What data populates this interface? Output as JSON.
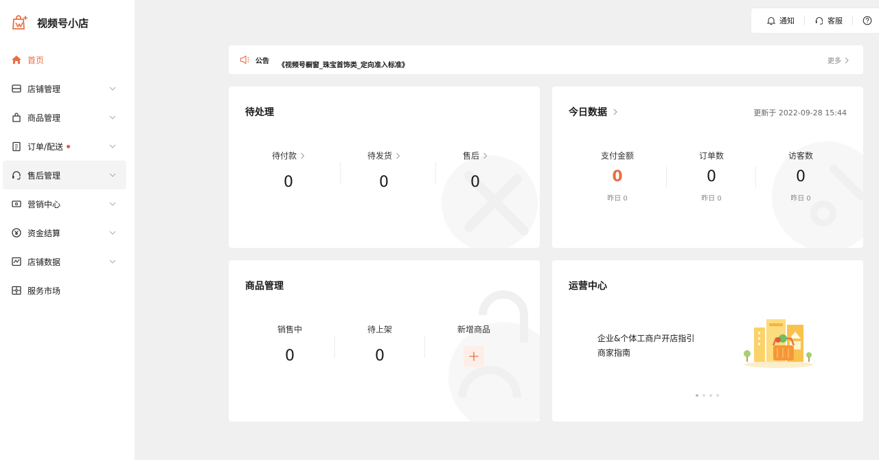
{
  "app": {
    "name": "视频号小店"
  },
  "sidebar": {
    "items": [
      {
        "label": "首页",
        "icon": "home-icon"
      },
      {
        "label": "店铺管理",
        "icon": "store-icon"
      },
      {
        "label": "商品管理",
        "icon": "shopping-bag-icon"
      },
      {
        "label": "订单/配送",
        "icon": "clipboard-icon"
      },
      {
        "label": "售后管理",
        "icon": "headset-icon"
      },
      {
        "label": "营销中心",
        "icon": "ticket-icon"
      },
      {
        "label": "资金结算",
        "icon": "yen-icon"
      },
      {
        "label": "店铺数据",
        "icon": "chart-icon"
      },
      {
        "label": "服务市场",
        "icon": "puzzle-icon"
      }
    ]
  },
  "topbar": {
    "notify": "通知",
    "service": "客服"
  },
  "notice": {
    "label": "公告",
    "text": "《视频号橱窗_珠宝首饰类_定向准入标准》",
    "more": "更多"
  },
  "pending": {
    "title": "待处理",
    "stats": [
      {
        "label": "待付款",
        "value": "0"
      },
      {
        "label": "待发货",
        "value": "0"
      },
      {
        "label": "售后",
        "value": "0"
      }
    ]
  },
  "today": {
    "title": "今日数据",
    "updated": "更新于 2022-09-28 15:44",
    "stats": [
      {
        "label": "支付金额",
        "value": "0",
        "sub": "昨日 0"
      },
      {
        "label": "订单数",
        "value": "0",
        "sub": "昨日 0"
      },
      {
        "label": "访客数",
        "value": "0",
        "sub": "昨日 0"
      }
    ]
  },
  "products": {
    "title": "商品管理",
    "stats": [
      {
        "label": "销售中",
        "value": "0"
      },
      {
        "label": "待上架",
        "value": "0"
      },
      {
        "label": "新增商品"
      }
    ]
  },
  "ops": {
    "title": "运营中心",
    "line1": "企业&个体工商户开店指引",
    "line2": "商家指南"
  },
  "colors": {
    "accent": "#e96e42",
    "background": "#f0f0f0",
    "card": "#ffffff"
  }
}
